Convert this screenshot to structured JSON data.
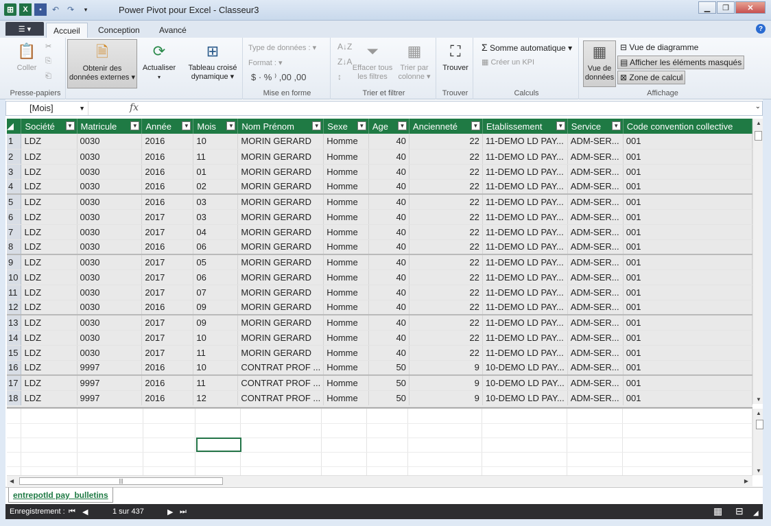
{
  "window": {
    "title": "Power Pivot pour Excel - Classeur3"
  },
  "tabs": {
    "file_icon": "menu-icon",
    "items": [
      "Accueil",
      "Conception",
      "Avancé"
    ],
    "active": "Accueil"
  },
  "ribbon": {
    "presse_papiers": {
      "label": "Presse-papiers",
      "coller": "Coller"
    },
    "obtenir": {
      "line1": "Obtenir des",
      "line2": "données externes"
    },
    "actualiser": "Actualiser",
    "tableau": {
      "line1": "Tableau croisé",
      "line2": "dynamique"
    },
    "mise_en_forme": {
      "label": "Mise en forme",
      "type": "Type de données :",
      "format": "Format :",
      "symbols": "$  ·  %  ⁾   ,00  ,00"
    },
    "trier": {
      "label": "Trier et filtrer",
      "effacer1": "Effacer tous",
      "effacer2": "les filtres",
      "trier1": "Trier par",
      "trier2": "colonne"
    },
    "trouver": {
      "label": "Trouver",
      "button": "Trouver"
    },
    "calculs": {
      "label": "Calculs",
      "somme": "Somme automatique",
      "kpi": "Créer un KPI"
    },
    "affichage": {
      "label": "Affichage",
      "vue_donnees1": "Vue de",
      "vue_donnees2": "données",
      "diagramme": "Vue de diagramme",
      "masques": "Afficher les éléments masqués",
      "zone": "Zone de calcul"
    }
  },
  "formula_bar": {
    "name_box": "[Mois]",
    "fx": "fx",
    "value": ""
  },
  "table": {
    "columns": [
      "Société",
      "Matricule",
      "Année",
      "Mois",
      "Nom Prénom",
      "Sexe",
      "Age",
      "Ancienneté",
      "Etablissement",
      "Service",
      "Code convention collective"
    ],
    "rows": [
      [
        "1",
        "LDZ",
        "0030",
        "2016",
        "10",
        "MORIN GERARD",
        "Homme",
        "40",
        "22",
        "11-DEMO LD PAY...",
        "ADM-SER...",
        "001"
      ],
      [
        "2",
        "LDZ",
        "0030",
        "2016",
        "11",
        "MORIN GERARD",
        "Homme",
        "40",
        "22",
        "11-DEMO LD PAY...",
        "ADM-SER...",
        "001"
      ],
      [
        "3",
        "LDZ",
        "0030",
        "2016",
        "01",
        "MORIN GERARD",
        "Homme",
        "40",
        "22",
        "11-DEMO LD PAY...",
        "ADM-SER...",
        "001"
      ],
      [
        "4",
        "LDZ",
        "0030",
        "2016",
        "02",
        "MORIN GERARD",
        "Homme",
        "40",
        "22",
        "11-DEMO LD PAY...",
        "ADM-SER...",
        "001"
      ],
      [
        "5",
        "LDZ",
        "0030",
        "2016",
        "03",
        "MORIN GERARD",
        "Homme",
        "40",
        "22",
        "11-DEMO LD PAY...",
        "ADM-SER...",
        "001"
      ],
      [
        "6",
        "LDZ",
        "0030",
        "2017",
        "03",
        "MORIN GERARD",
        "Homme",
        "40",
        "22",
        "11-DEMO LD PAY...",
        "ADM-SER...",
        "001"
      ],
      [
        "7",
        "LDZ",
        "0030",
        "2017",
        "04",
        "MORIN GERARD",
        "Homme",
        "40",
        "22",
        "11-DEMO LD PAY...",
        "ADM-SER...",
        "001"
      ],
      [
        "8",
        "LDZ",
        "0030",
        "2016",
        "06",
        "MORIN GERARD",
        "Homme",
        "40",
        "22",
        "11-DEMO LD PAY...",
        "ADM-SER...",
        "001"
      ],
      [
        "9",
        "LDZ",
        "0030",
        "2017",
        "05",
        "MORIN GERARD",
        "Homme",
        "40",
        "22",
        "11-DEMO LD PAY...",
        "ADM-SER...",
        "001"
      ],
      [
        "10",
        "LDZ",
        "0030",
        "2017",
        "06",
        "MORIN GERARD",
        "Homme",
        "40",
        "22",
        "11-DEMO LD PAY...",
        "ADM-SER...",
        "001"
      ],
      [
        "11",
        "LDZ",
        "0030",
        "2017",
        "07",
        "MORIN GERARD",
        "Homme",
        "40",
        "22",
        "11-DEMO LD PAY...",
        "ADM-SER...",
        "001"
      ],
      [
        "12",
        "LDZ",
        "0030",
        "2016",
        "09",
        "MORIN GERARD",
        "Homme",
        "40",
        "22",
        "11-DEMO LD PAY...",
        "ADM-SER...",
        "001"
      ],
      [
        "13",
        "LDZ",
        "0030",
        "2017",
        "09",
        "MORIN GERARD",
        "Homme",
        "40",
        "22",
        "11-DEMO LD PAY...",
        "ADM-SER...",
        "001"
      ],
      [
        "14",
        "LDZ",
        "0030",
        "2017",
        "10",
        "MORIN GERARD",
        "Homme",
        "40",
        "22",
        "11-DEMO LD PAY...",
        "ADM-SER...",
        "001"
      ],
      [
        "15",
        "LDZ",
        "0030",
        "2017",
        "11",
        "MORIN GERARD",
        "Homme",
        "40",
        "22",
        "11-DEMO LD PAY...",
        "ADM-SER...",
        "001"
      ],
      [
        "16",
        "LDZ",
        "9997",
        "2016",
        "10",
        "CONTRAT PROF ...",
        "Homme",
        "50",
        "9",
        "10-DEMO LD PAY...",
        "ADM-SER...",
        "001"
      ],
      [
        "17",
        "LDZ",
        "9997",
        "2016",
        "11",
        "CONTRAT PROF ...",
        "Homme",
        "50",
        "9",
        "10-DEMO LD PAY...",
        "ADM-SER...",
        "001"
      ],
      [
        "18",
        "LDZ",
        "9997",
        "2016",
        "12",
        "CONTRAT PROF ...",
        "Homme",
        "50",
        "9",
        "10-DEMO LD PAY...",
        "ADM-SER...",
        "001"
      ]
    ]
  },
  "sheet_tab": "entrepotId pay_bulletins",
  "status": {
    "label": "Enregistrement :",
    "position": "1 sur 437"
  },
  "colors": {
    "header_green": "#1f7a44",
    "status_dark": "#2d2d30"
  }
}
